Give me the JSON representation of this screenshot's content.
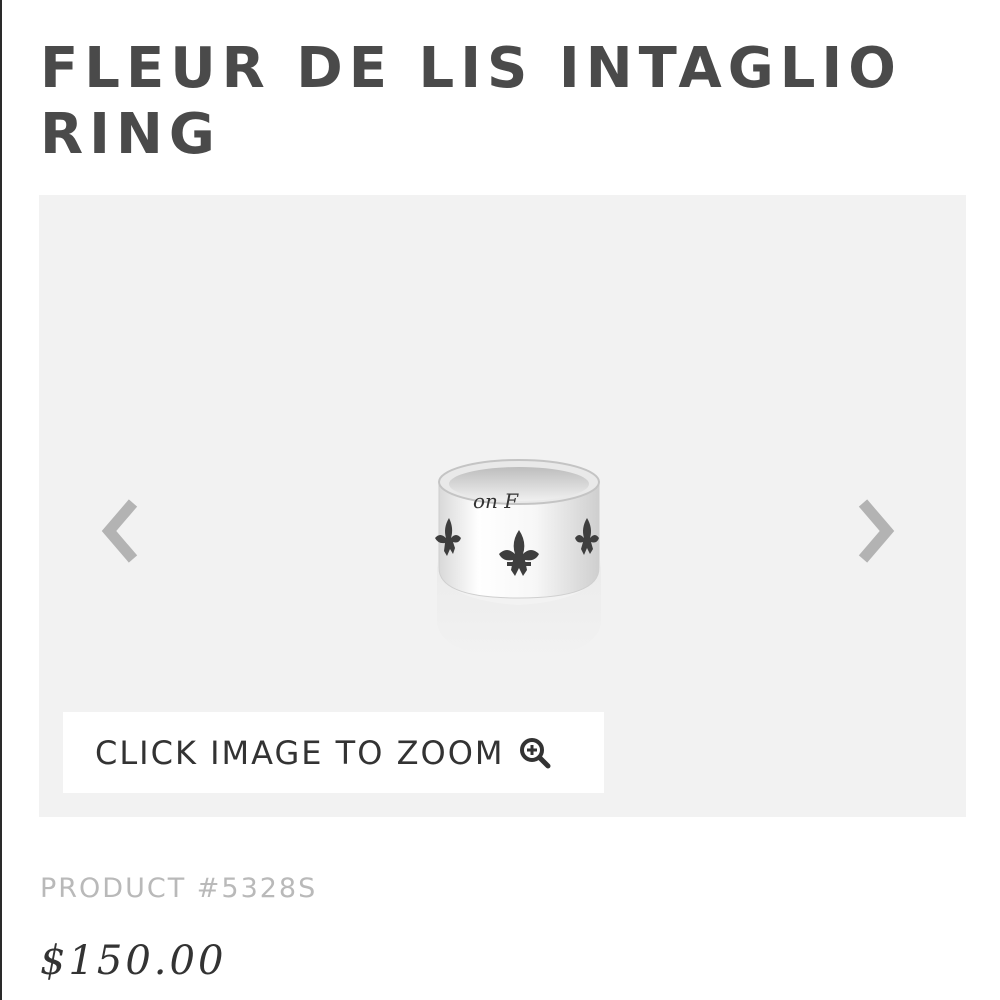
{
  "product": {
    "title": "FLEUR DE LIS INTAGLIO RING",
    "product_number": "PRODUCT #5328S",
    "price": "$150.00"
  },
  "gallery": {
    "zoom_label": "CLICK IMAGE TO ZOOM",
    "zoom_icon": "zoom-in-icon",
    "prev_icon": "chevron-left-icon",
    "next_icon": "chevron-right-icon",
    "background_color": "#f2f2f2",
    "arrow_color": "#b3b3b3"
  }
}
